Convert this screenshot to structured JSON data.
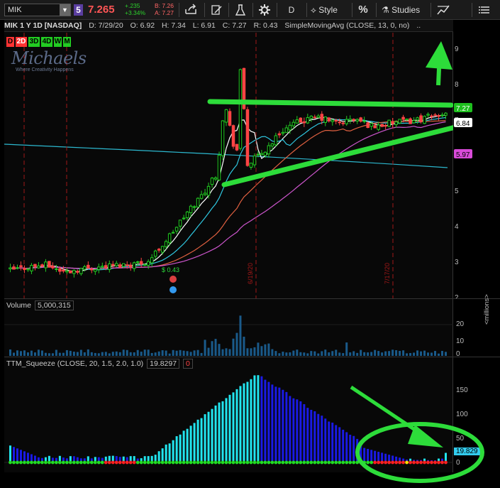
{
  "toolbar": {
    "symbol": "MIK",
    "link_num": "5",
    "last": "7.265",
    "change": "+.235",
    "change_pct": "+3.34%",
    "bid": "B: 7.26",
    "ask": "A: 7.27",
    "timeframe": "D",
    "style_label": "Style",
    "pct_label": "%",
    "studies_label": "Studies"
  },
  "header": {
    "title": "MIK 1 Y 1D [NASDAQ]",
    "date": "D: 7/29/20",
    "open": "O: 6.92",
    "high": "H: 7.34",
    "low": "L: 6.91",
    "close": "C: 7.27",
    "range": "R: 0.43",
    "study": "SimpleMovingAvg (CLOSE, 13, 0, no)",
    "more": ".."
  },
  "aggregations": [
    {
      "label": "D",
      "bg": "#ff3333",
      "fg": "#000"
    },
    {
      "label": "2D",
      "bg": "#ff3333",
      "fg": "#fff"
    },
    {
      "label": "3D",
      "bg": "#22cc22",
      "fg": "#000"
    },
    {
      "label": "4D",
      "bg": "#22cc22",
      "fg": "#000"
    },
    {
      "label": "W",
      "bg": "#22cc22",
      "fg": "#000"
    },
    {
      "label": "M",
      "bg": "#22cc22",
      "fg": "#000"
    }
  ],
  "logo": {
    "name": "Michaels",
    "tagline": "Where Creativity Happens"
  },
  "price_axis": {
    "ticks": [
      "9",
      "8",
      "7",
      "6",
      "5",
      "4",
      "3",
      "2"
    ]
  },
  "price_bubbles": [
    {
      "value": "7.27",
      "bg": "#1ec01e",
      "fg": "#fff"
    },
    {
      "value": "6.84",
      "bg": "#ffffff",
      "fg": "#000"
    },
    {
      "value": "5.97",
      "bg": "#d94bd9",
      "fg": "#000"
    }
  ],
  "date_labels": [
    "6/19/20",
    "7/17/20"
  ],
  "event_label": "$ 0.43",
  "volume": {
    "title": "Volume",
    "value": "5,000,315",
    "axis_label": "<millions>",
    "ticks": [
      "20",
      "10",
      "0"
    ]
  },
  "squeeze": {
    "title": "TTM_Squeeze (CLOSE, 20, 1.5, 2.0, 1.0)",
    "value": "19.8297",
    "alert": "0",
    "ticks": [
      "150",
      "100",
      "50",
      "0"
    ],
    "bubble": "19.829"
  },
  "colors": {
    "up": "#22cc22",
    "down": "#ff4444",
    "annotation": "#2ddc3a"
  }
}
